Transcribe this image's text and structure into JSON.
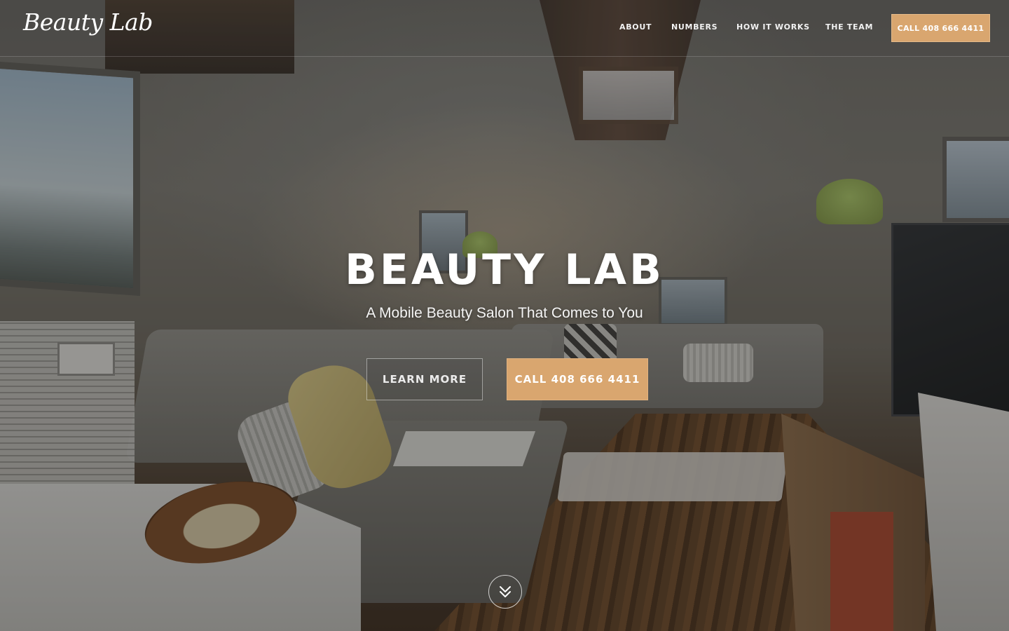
{
  "brand": {
    "logo_text": "Beauty Lab",
    "accent_color": "#d9a66f"
  },
  "nav": {
    "items": [
      {
        "label": "ABOUT"
      },
      {
        "label": "NUMBERS"
      },
      {
        "label": "HOW IT WORKS"
      },
      {
        "label": "THE TEAM"
      }
    ],
    "cta_label": "CALL 408 666 4411"
  },
  "hero": {
    "title": "BEAUTY LAB",
    "subtitle": "A Mobile Beauty Salon That Comes to You",
    "primary_button": "LEARN MORE",
    "secondary_button": "CALL 408 666 4411",
    "scroll_icon": "double-chevron-down-icon",
    "background_image": "airstream-trailer-salon-interior"
  }
}
